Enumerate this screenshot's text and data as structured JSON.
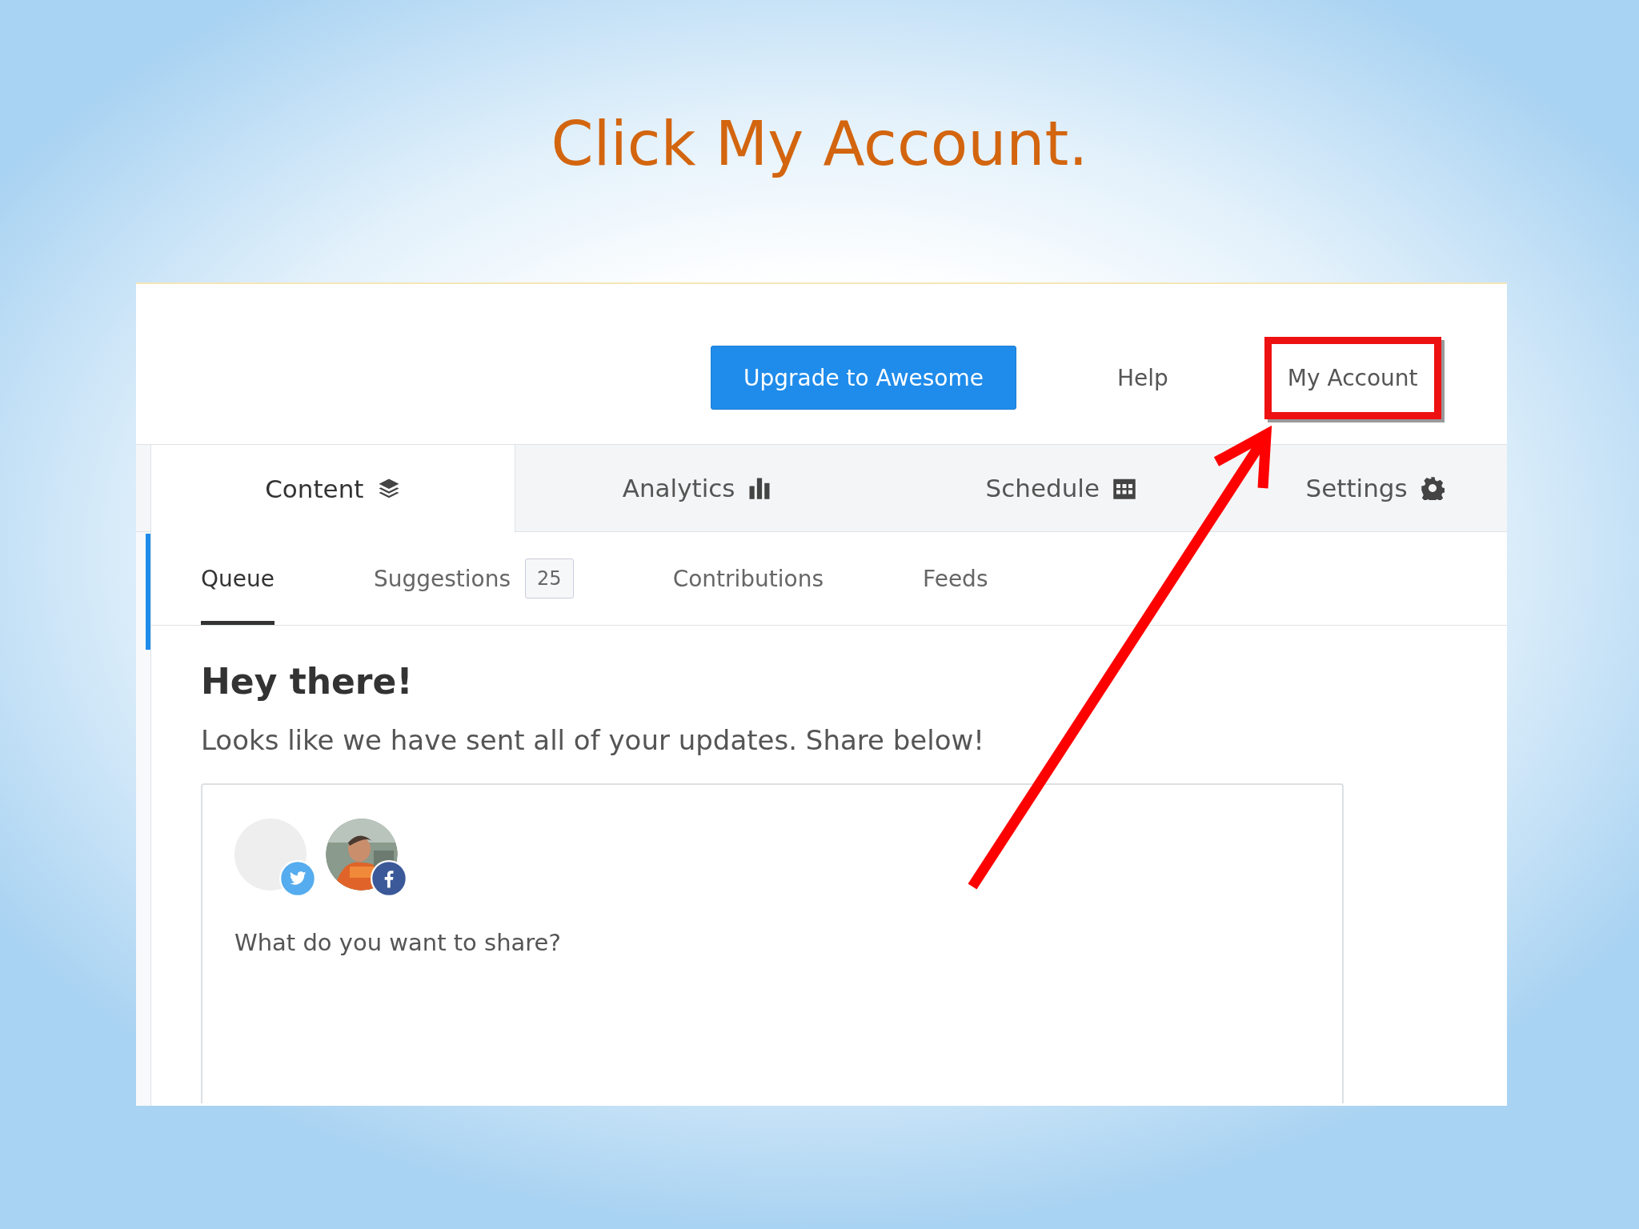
{
  "slide_title": "Click My Account.",
  "header": {
    "upgrade_button": "Upgrade to Awesome",
    "links": [
      {
        "label": "Help",
        "highlighted": false
      },
      {
        "label": "My Account",
        "highlighted": true
      }
    ]
  },
  "tabs": [
    {
      "label": "Content",
      "kind": "layers",
      "selected": true
    },
    {
      "label": "Analytics",
      "kind": "bars",
      "selected": false
    },
    {
      "label": "Schedule",
      "kind": "calendar",
      "selected": false
    },
    {
      "label": "Settings",
      "kind": "gear",
      "selected": false
    }
  ],
  "subtabs": [
    {
      "label": "Queue",
      "selected": true
    },
    {
      "label": "Suggestions",
      "count": "25",
      "selected": false
    },
    {
      "label": "Contributions",
      "selected": false
    },
    {
      "label": "Feeds",
      "selected": false
    }
  ],
  "heading": "Hey there!",
  "message": "Looks like we have sent all of your updates. Share below!",
  "composer": {
    "accounts": [
      {
        "kind": "twitter"
      },
      {
        "kind": "facebook"
      }
    ],
    "placeholder": "What do you want to share?"
  }
}
